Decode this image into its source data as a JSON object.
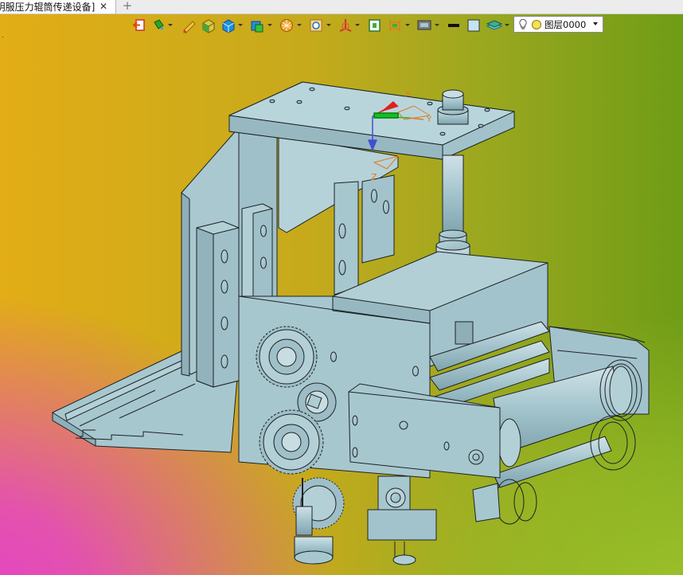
{
  "document_tab": {
    "title": "[明服压力辊筒传递设备]",
    "close_glyph": "✕",
    "new_tab_glyph": "+"
  },
  "toolbar": {
    "items": [
      {
        "icon": "exit-icon"
      },
      {
        "icon": "paint-bucket-icon",
        "dropdown": true
      },
      {
        "icon": "pencil-icon"
      },
      {
        "icon": "solid-box-icon"
      },
      {
        "icon": "blue-cube-icon",
        "dropdown": true
      },
      {
        "icon": "view-cube-icon",
        "dropdown": true
      },
      {
        "icon": "orange-sphere-icon",
        "dropdown": true
      },
      {
        "icon": "zoom-fit-icon",
        "dropdown": true
      },
      {
        "icon": "axis-triad-icon",
        "dropdown": true
      },
      {
        "icon": "page-setup-icon"
      },
      {
        "icon": "dimension-icon",
        "dropdown": true
      },
      {
        "icon": "display-mode-icon",
        "dropdown": true
      },
      {
        "icon": "line-weight-icon"
      },
      {
        "icon": "color-swatch-icon"
      },
      {
        "icon": "layer-manager-icon",
        "dropdown": true
      }
    ],
    "layer_selector": {
      "bulb_icon": "light-bulb-icon",
      "status_icon": "layer-status-icon",
      "value": "图层0000"
    }
  },
  "viewport": {
    "model": "pressure-roller-transfer-machine",
    "axis_labels": {
      "x": "X",
      "y": "Y",
      "z": "Z"
    },
    "colors": {
      "part": "#a7c7cf",
      "edge": "#1c2326",
      "axis_x": "#e02020",
      "axis_y": "#10c020",
      "axis_z": "#4050d0",
      "datum": "#e07a20"
    }
  }
}
